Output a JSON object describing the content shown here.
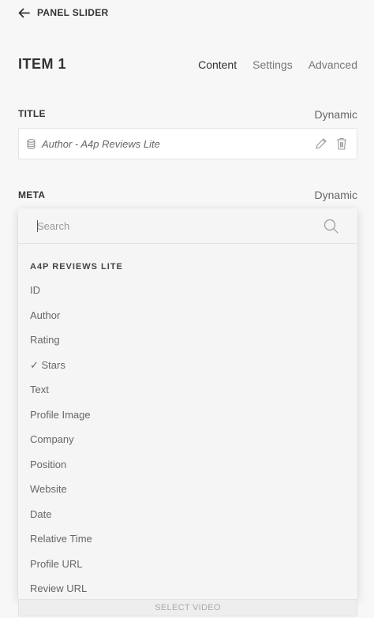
{
  "header": {
    "back_label": "PANEL SLIDER"
  },
  "item": {
    "title": "ITEM 1"
  },
  "tabs": [
    {
      "label": "Content",
      "active": true
    },
    {
      "label": "Settings",
      "active": false
    },
    {
      "label": "Advanced",
      "active": false
    }
  ],
  "title_field": {
    "label": "TITLE",
    "dynamic_label": "Dynamic",
    "value": "Author - A4p Reviews Lite"
  },
  "meta_field": {
    "label": "META",
    "dynamic_label": "Dynamic"
  },
  "dropdown": {
    "search_placeholder": "Search",
    "group_heading": "A4P REVIEWS LITE",
    "options": [
      "ID",
      "Author",
      "Rating",
      "✓ Stars",
      "Text",
      "Profile Image",
      "Company",
      "Position",
      "Website",
      "Date",
      "Relative Time",
      "Profile URL",
      "Review URL"
    ]
  },
  "footer": {
    "select_video_label": "SELECT VIDEO"
  },
  "icons": {
    "back": "arrow-left-icon",
    "database": "database-icon",
    "edit": "pencil-icon",
    "delete": "trash-icon",
    "search": "search-icon"
  },
  "colors": {
    "background": "#f7f7f7",
    "text_primary": "#333333",
    "text_secondary": "#666666",
    "field_background": "#ffffff"
  }
}
